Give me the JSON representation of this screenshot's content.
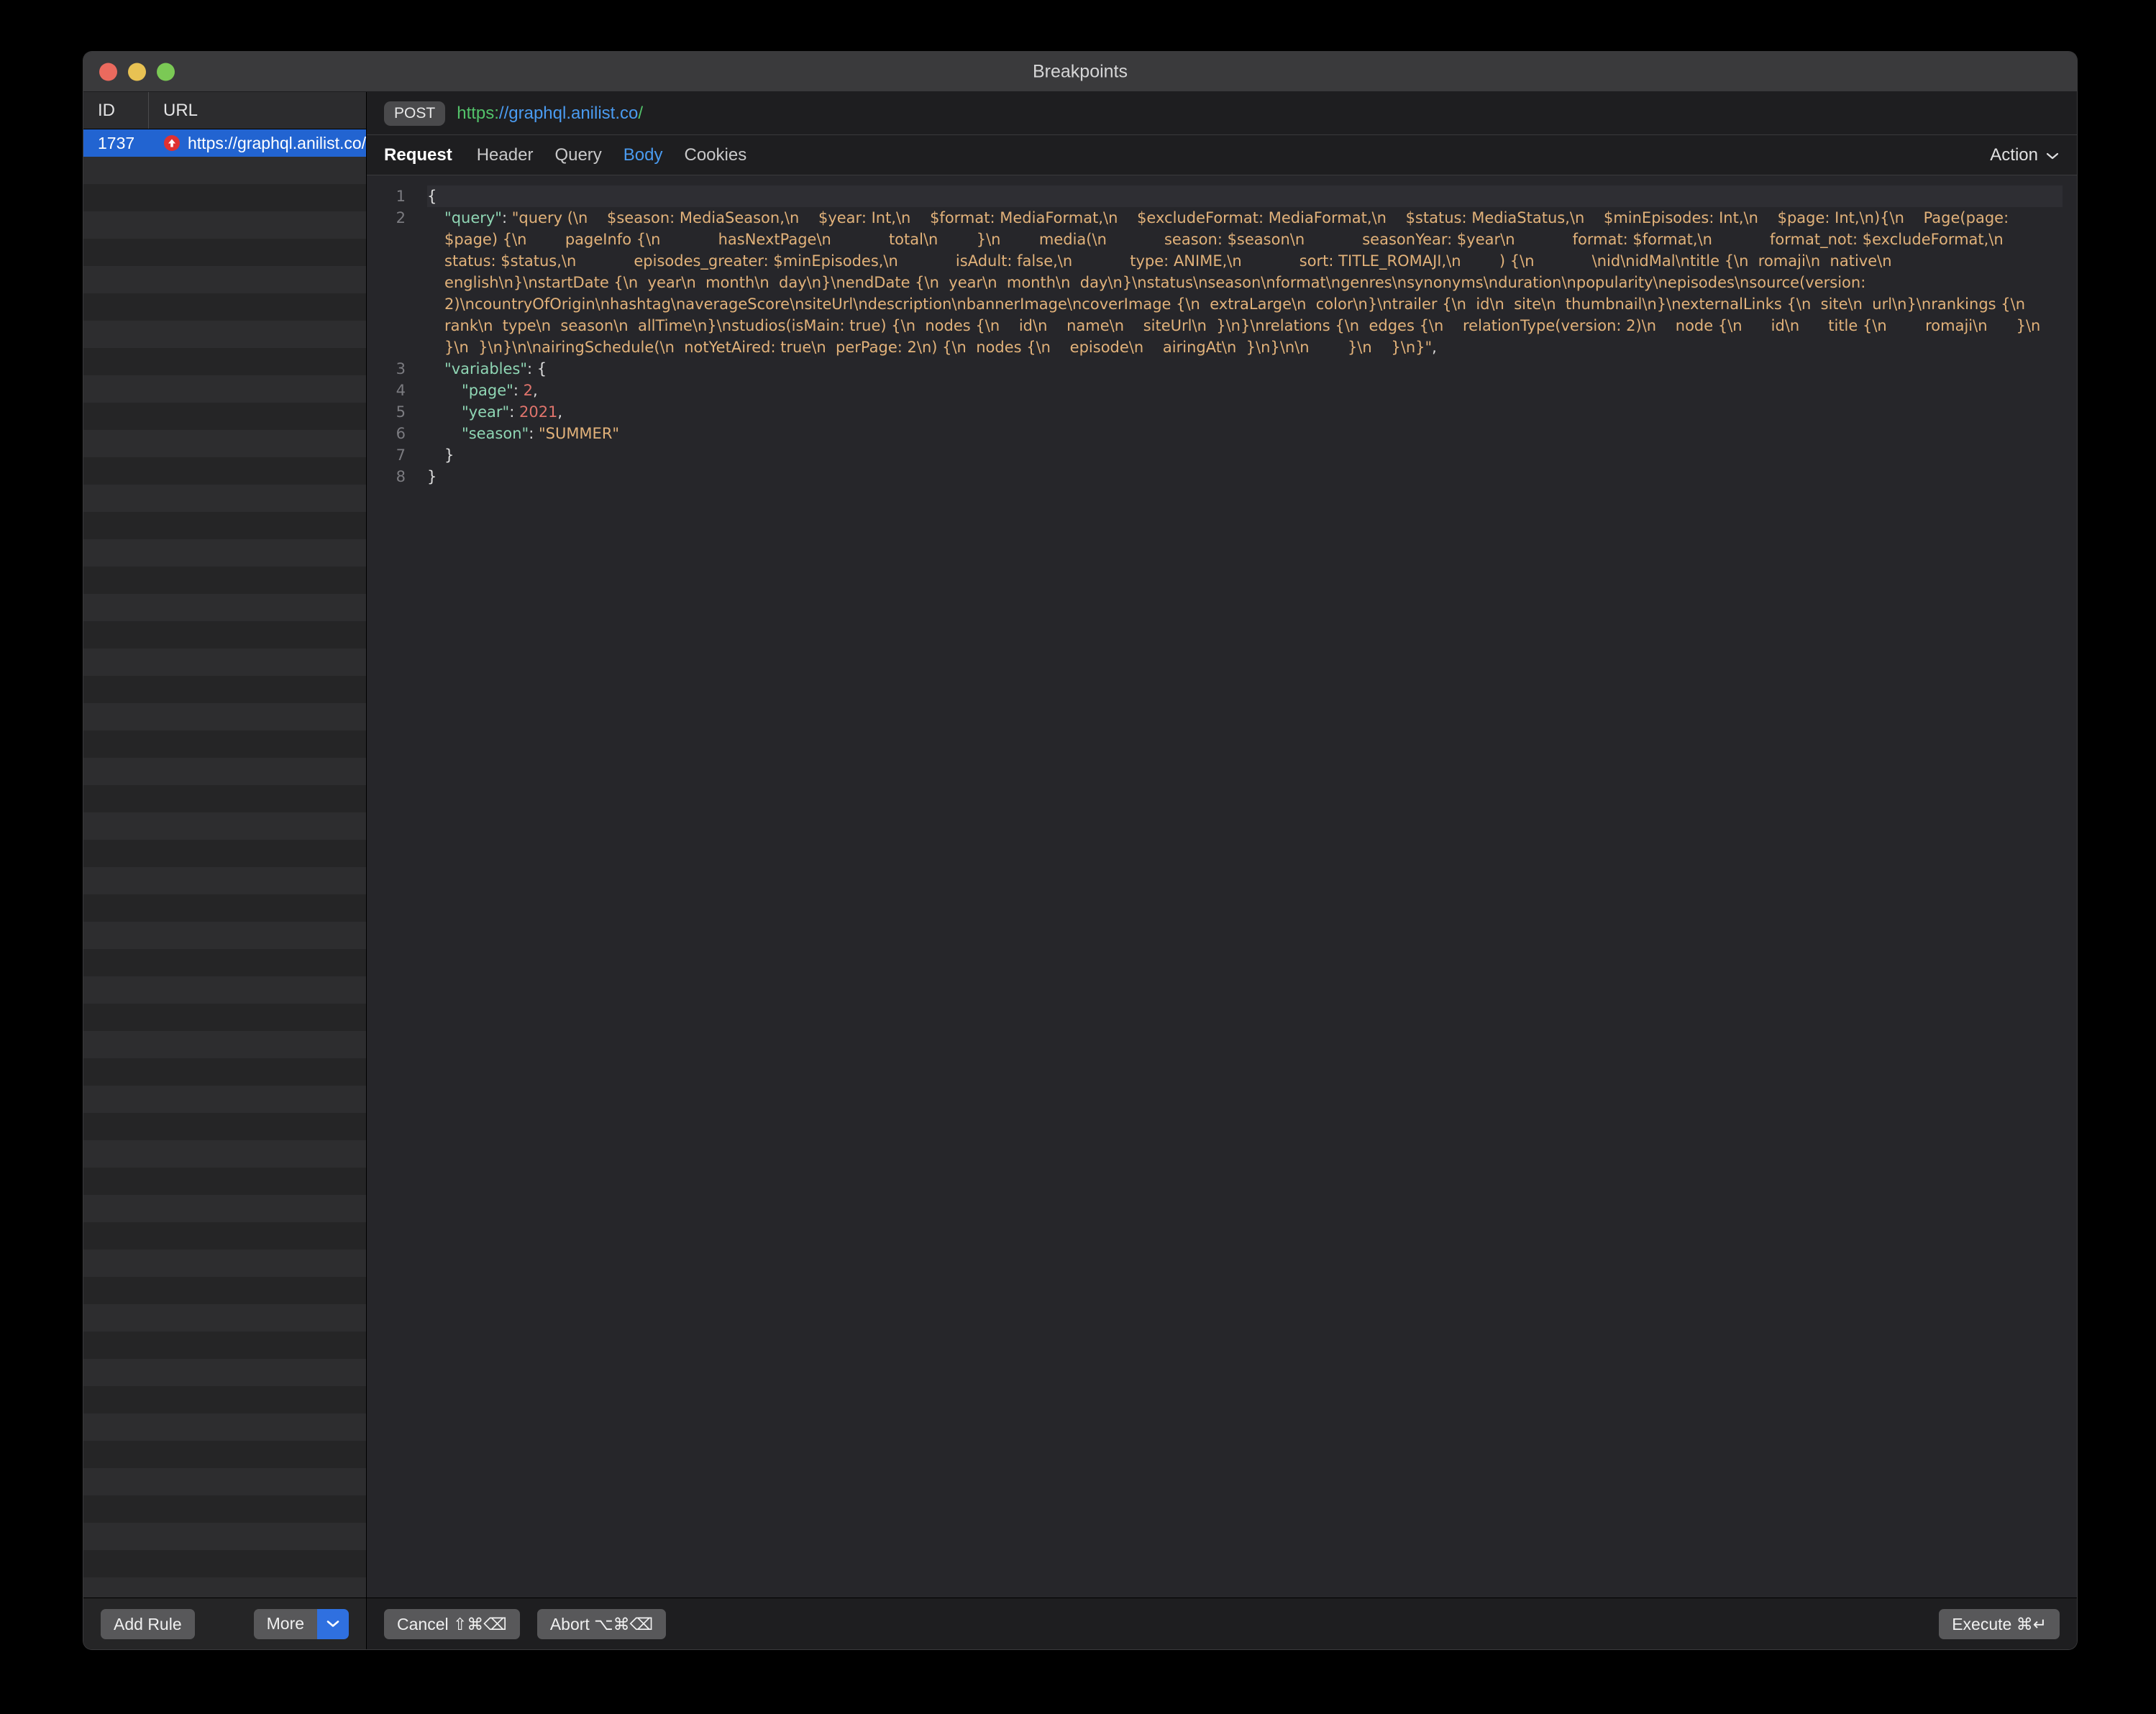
{
  "window": {
    "title": "Breakpoints",
    "controls": [
      "close",
      "minimize",
      "maximize"
    ]
  },
  "left_panel": {
    "columns": [
      {
        "label": "ID"
      },
      {
        "label": "URL"
      }
    ],
    "rows": [
      {
        "id": "1737",
        "url": "https://graphql.anilist.co/",
        "icon": "breakpoint-up-arrow-icon",
        "selected": true
      }
    ],
    "empty_row_count": 53,
    "footer": {
      "add_rule_label": "Add Rule",
      "more_label": "More",
      "more_chevron_icon": "chevron-down-icon",
      "more_chevron_color": "#2f70e0"
    }
  },
  "right_panel": {
    "method": "POST",
    "url": {
      "scheme": "https:",
      "host": "//graphql.anilist.co",
      "path": "/",
      "full": "https://graphql.anilist.co/"
    },
    "tabs": [
      {
        "label": "Request",
        "style": "strong",
        "active": false
      },
      {
        "label": "Header",
        "style": "normal",
        "active": false
      },
      {
        "label": "Query",
        "style": "normal",
        "active": false
      },
      {
        "label": "Body",
        "style": "normal",
        "active": true
      },
      {
        "label": "Cookies",
        "style": "normal",
        "active": false
      }
    ],
    "action_menu": {
      "label": "Action",
      "chevron_icon": "chevron-down-icon"
    },
    "editor": {
      "line_numbers": [
        "1",
        "2",
        "3",
        "4",
        "5",
        "6",
        "7",
        "8"
      ],
      "foldable_lines": [
        "1",
        "3"
      ],
      "lines": {
        "l1_brace": "{",
        "l2_key": "\"query\"",
        "l2_colon": ": ",
        "l2_value": "\"query (\\n    $season: MediaSeason,\\n    $year: Int,\\n    $format: MediaFormat,\\n    $excludeFormat: MediaFormat,\\n    $status: MediaStatus,\\n    $minEpisodes: Int,\\n    $page: Int,\\n){\\n    Page(page: $page) {\\n        pageInfo {\\n            hasNextPage\\n            total\\n        }\\n        media(\\n            season: $season\\n            seasonYear: $year\\n            format: $format,\\n            format_not: $excludeFormat,\\n            status: $status,\\n            episodes_greater: $minEpisodes,\\n            isAdult: false,\\n            type: ANIME,\\n            sort: TITLE_ROMAJI,\\n        ) {\\n            \\nid\\nidMal\\ntitle {\\n  romaji\\n  native\\n  english\\n}\\nstartDate {\\n  year\\n  month\\n  day\\n}\\nendDate {\\n  year\\n  month\\n  day\\n}\\nstatus\\nseason\\nformat\\ngenres\\nsynonyms\\nduration\\npopularity\\nepisodes\\nsource(version: 2)\\ncountryOfOrigin\\nhashtag\\naverageScore\\nsiteUrl\\ndescription\\nbannerImage\\ncoverImage {\\n  extraLarge\\n  color\\n}\\ntrailer {\\n  id\\n  site\\n  thumbnail\\n}\\nexternalLinks {\\n  site\\n  url\\n}\\nrankings {\\n  rank\\n  type\\n  season\\n  allTime\\n}\\nstudios(isMain: true) {\\n  nodes {\\n    id\\n    name\\n    siteUrl\\n  }\\n}\\nrelations {\\n  edges {\\n    relationType(version: 2)\\n    node {\\n      id\\n      title {\\n        romaji\\n      }\\n    }\\n  }\\n}\\n\\nairingSchedule(\\n  notYetAired: true\\n  perPage: 2\\n) {\\n  nodes {\\n    episode\\n    airingAt\\n  }\\n}\\n\\n        }\\n    }\\n}\"",
        "l2_trail": ",",
        "l3_key": "\"variables\"",
        "l3_rest": ": {",
        "l4_key": "\"page\"",
        "l4_colon": ": ",
        "l4_num": "2",
        "l4_trail": ",",
        "l5_key": "\"year\"",
        "l5_colon": ": ",
        "l5_num": "2021",
        "l5_trail": ",",
        "l6_key": "\"season\"",
        "l6_colon": ": ",
        "l6_str": "\"SUMMER\"",
        "l7_brace": "}",
        "l8_brace": "}"
      },
      "colors": {
        "key": "#8fd6b4",
        "string": "#e2b27a",
        "number": "#e0746c",
        "punctuation": "#dcdcdc",
        "line_number": "#7b7b80",
        "background": "#26262a"
      }
    },
    "footer": {
      "cancel_label": "Cancel ⇧⌘⌫",
      "abort_label": "Abort ⌥⌘⌫",
      "execute_label": "Execute ⌘↵"
    }
  }
}
